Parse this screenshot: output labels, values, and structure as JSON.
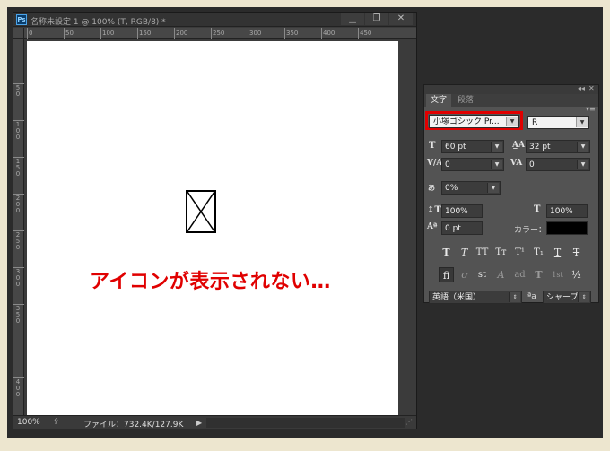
{
  "app": {
    "logo": "Ps",
    "title": "名称未設定 1 @ 100% (T, RGB/8) *"
  },
  "window_buttons": [
    "▁",
    "❐",
    "✕"
  ],
  "ruler": {
    "horizontal": [
      "0",
      "50",
      "100",
      "150",
      "200",
      "250",
      "300",
      "350",
      "400",
      "450"
    ],
    "vertical": [
      "5\n0",
      "1\n0\n0",
      "1\n5\n0",
      "2\n0\n0",
      "2\n5\n0",
      "3\n0\n0",
      "3\n5\n0",
      "4\n0\n0"
    ]
  },
  "canvas": {
    "broken_image_icon": "broken-image-icon",
    "note": "アイコンが表示されない…"
  },
  "status": {
    "zoom": "100%",
    "file_info": "ファイル：732.4K/127.9K",
    "arrow": "▶"
  },
  "panel": {
    "collapse": "◂◂",
    "close": "✕",
    "menu": "▾≡",
    "tabs": [
      "文字",
      "段落"
    ],
    "font_family": "小塚ゴシック Pr...",
    "font_style": "R",
    "font_size": "60 pt",
    "leading": "32 pt",
    "kerning": "0",
    "tracking": "0",
    "tsume": "0%",
    "vertical_scale": "100%",
    "horizontal_scale": "100%",
    "baseline_shift": "0 pt",
    "color_label": "カラー：",
    "color": "#000000",
    "style_buttons": [
      "T",
      "T",
      "TT",
      "Tт",
      "T¹",
      "T₁",
      "T",
      "T"
    ],
    "opentype_buttons": [
      "ﬁ",
      "ơ",
      "st",
      "A",
      "ad",
      "T",
      "1st",
      "½"
    ],
    "language": "英語（米国）",
    "aa_label": "ªa",
    "antialias": "シャープ"
  },
  "colors": {
    "highlight": "#e00000",
    "canvas": "#ffffff"
  }
}
